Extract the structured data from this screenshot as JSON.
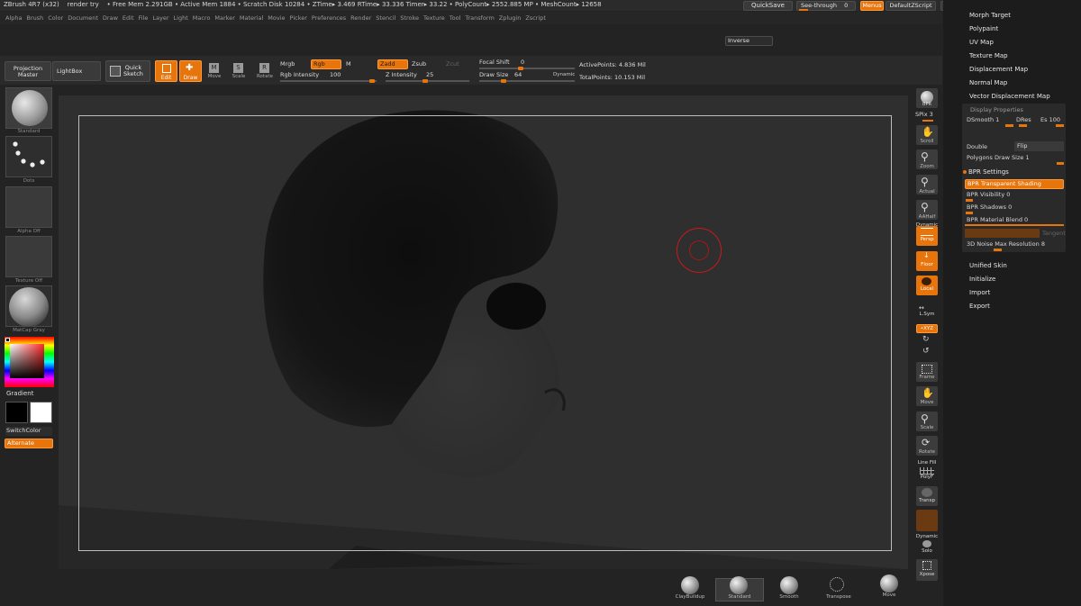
{
  "title": {
    "app": "ZBrush 4R7 (x32)",
    "doc": "render try",
    "stats": "• Free Mem 2.291GB • Active Mem 1884 • Scratch Disk 10284 • ZTime▸ 3.469 RTime▸ 33.336 Timer▸ 33.22 • PolyCount▸ 2552.885 MP • MeshCount▸ 12658"
  },
  "titlebar_right": {
    "quicksave": "QuickSave",
    "seethrough": "See-through",
    "seethrough_value": "0",
    "menus": "Menus",
    "script": "DefaultZScript"
  },
  "menus": [
    "Alpha",
    "Brush",
    "Color",
    "Document",
    "Draw",
    "Edit",
    "File",
    "Layer",
    "Light",
    "Macro",
    "Marker",
    "Material",
    "Movie",
    "Picker",
    "Preferences",
    "Render",
    "Stencil",
    "Stroke",
    "Texture",
    "Tool",
    "Transform",
    "Zplugin",
    "Zscript"
  ],
  "inverse": "Inverse",
  "toolbar": {
    "projection_master": "Projection\nMaster",
    "lightbox": "LightBox",
    "quick_sketch": "Quick\nSketch",
    "edit": "Edit",
    "draw": "Draw",
    "move": "Move",
    "scale": "Scale",
    "rotate": "Rotate",
    "mrgb": "Mrgb",
    "rgb": "Rgb",
    "m": "M",
    "rgb_intensity_label": "Rgb  Intensity",
    "rgb_intensity": "100",
    "zadd": "Zadd",
    "zsub": "Zsub",
    "zcut": "Zcut",
    "z_intensity_label": "Z  Intensity",
    "z_intensity": "25",
    "focal_label": "Focal  Shift",
    "focal_shift": "0",
    "draw_size_label": "Draw  Size",
    "draw_size": "64",
    "dynamic": "Dynamic",
    "active_points_label": "ActivePoints:",
    "active_points": "4.836  Mil",
    "total_points_label": "TotalPoints:",
    "total_points": "10.153  Mil"
  },
  "left_shelf": {
    "brush": "Standard",
    "stroke": "Dots",
    "alpha": "Alpha  Off",
    "texture": "Texture  Off",
    "material": "MatCap  Gray",
    "gradient": "Gradient",
    "switchcolor": "SwitchColor",
    "alternate": "Alternate"
  },
  "right_shelf": {
    "bpr": "BPR",
    "spix_label": "SPix",
    "spix": "3",
    "scroll": "Scroll",
    "zoom": "Zoom",
    "actual": "Actual",
    "aahalf": "AAHalf",
    "dynamic": "Dynamic",
    "persp": "Persp",
    "floor": "Floor",
    "local": "Local",
    "lsym": "L.Sym",
    "xyz": "•XYZ",
    "frame": "Frame",
    "move": "Move",
    "scale": "Scale",
    "rotate": "Rotate",
    "linefill": "Line Fill",
    "polyf": "PolyF",
    "transp": "Transp",
    "dynamic2": "Dynamic",
    "solo": "Solo",
    "xpose": "Xpose"
  },
  "right_panel": {
    "top_items": [
      "Morph Target",
      "Polypaint",
      "UV Map",
      "Texture Map",
      "Displacement Map",
      "Normal Map",
      "Vector Displacement Map"
    ],
    "display_properties": "Display Properties",
    "dsmooth_label": "DSmooth",
    "dsmooth": "1",
    "dres": "DRes",
    "es_label": "Es",
    "es": "100",
    "double": "Double",
    "flip": "Flip",
    "polygons_draw_size_label": "Polygons  Draw  Size",
    "polygons_draw_size": "1",
    "bpr_settings": "BPR  Settings",
    "bpr_transparent_shading": "BPR  Transparent  Shading",
    "bpr_visibility_label": "BPR  Visibility",
    "bpr_visibility": "0",
    "bpr_shadows_label": "BPR  Shadows",
    "bpr_shadows": "0",
    "bpr_material_blend_label": "BPR  Material  Blend",
    "bpr_material_blend": "0",
    "tangent": "Tangent",
    "noise_label": "3D  Noise  Max  Resolution",
    "noise_value": "8",
    "bottom_items": [
      "Unified Skin",
      "Initialize",
      "Import",
      "Export"
    ]
  },
  "bottom_shelf": [
    "ClayBuildup",
    "Standard",
    "Smooth",
    "Transpose",
    "Move"
  ],
  "colors": {
    "accent": "#e8740c",
    "canvas": "#2f2f2f",
    "panel": "#1c1c1c",
    "cursor_ring": "#d01818"
  }
}
